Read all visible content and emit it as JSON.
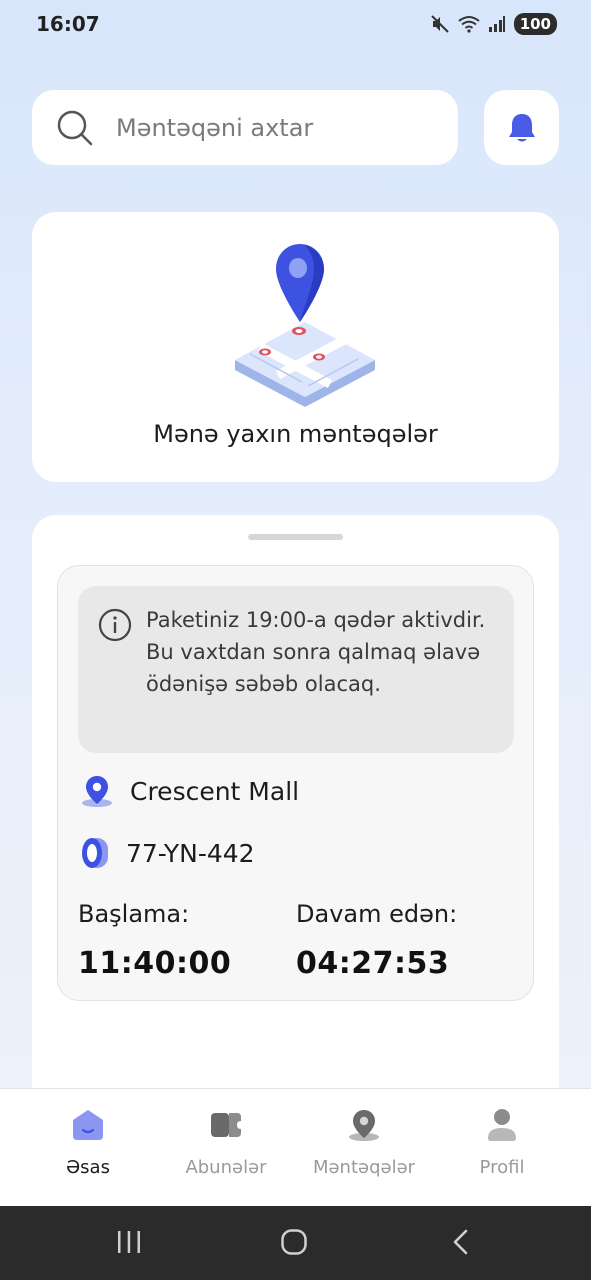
{
  "status_bar": {
    "time": "16:07",
    "battery": "100"
  },
  "search": {
    "placeholder": "Məntəqəni axtar",
    "value": ""
  },
  "nearby": {
    "label": "Mənə yaxın məntəqələr"
  },
  "session": {
    "info_text": "Paketiniz 19:00-a qədər aktivdir. Bu vaxtdan sonra qalmaq əlavə ödənişə səbəb olacaq.",
    "location": "Crescent Mall",
    "plate": "77-YN-442",
    "start_label": "Başlama:",
    "start_value": "11:40:00",
    "duration_label": "Davam edən:",
    "duration_value": "04:27:53"
  },
  "nav": {
    "items": [
      {
        "label": "Əsas",
        "icon": "home-icon",
        "active": true
      },
      {
        "label": "Abunələr",
        "icon": "ticket-icon",
        "active": false
      },
      {
        "label": "Məntəqələr",
        "icon": "map-pin-icon",
        "active": false
      },
      {
        "label": "Profil",
        "icon": "user-icon",
        "active": false
      }
    ]
  },
  "colors": {
    "accent": "#4a5be8",
    "accent_light": "#8a96f2",
    "nav_inactive": "#9a9a9a"
  }
}
